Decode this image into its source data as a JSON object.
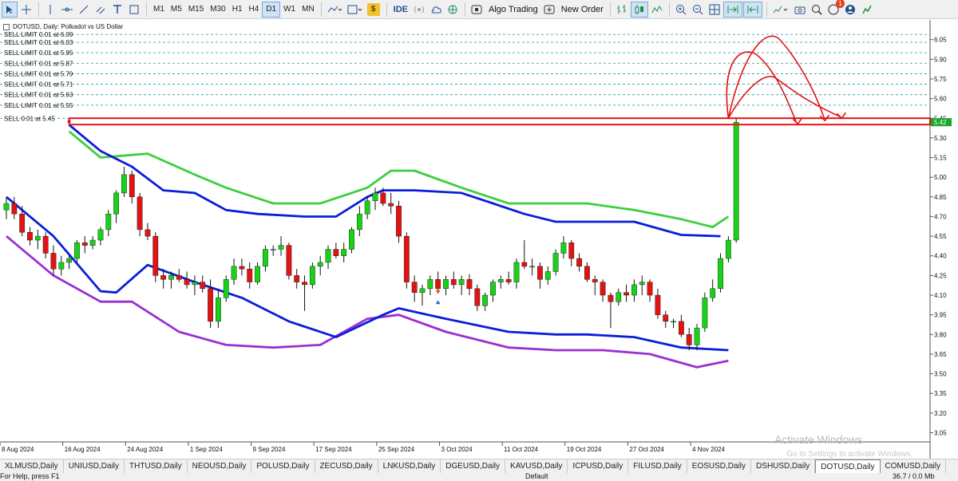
{
  "toolbar": {
    "timeframes": [
      "M1",
      "M5",
      "M15",
      "M30",
      "H1",
      "H4",
      "D1",
      "W1",
      "MN"
    ],
    "active_timeframe": "D1",
    "ide_label": "IDE",
    "algo_label": "Algo Trading",
    "new_order_label": "New Order",
    "notification_count": "1"
  },
  "chart": {
    "symbol": "DOTUSD",
    "timeframe": "Daily",
    "description": "Polkadot vs US Dollar",
    "header": "DOTUSD, Daily:  Polkadot vs US Dollar",
    "current_price": "5.42",
    "orders": [
      "SELL LIMIT 0.01 at 6.09",
      "SELL LIMIT 0.01 at 6.03",
      "SELL LIMIT 0.01 at 5.95",
      "SELL LIMIT 0.01 at 5.87",
      "SELL LIMIT 0.01 at 5.79",
      "SELL LIMIT 0.01 at 5.71",
      "SELL LIMIT 0.01 at 5.63",
      "SELL LIMIT 0.01 at 5.55",
      "SELL 0.01 at 5.45"
    ]
  },
  "chart_data": {
    "type": "candlestick",
    "title": "DOTUSD, Daily:  Polkadot vs US Dollar",
    "y_ticks": [
      6.05,
      5.9,
      5.75,
      5.6,
      5.45,
      5.3,
      5.15,
      5.0,
      4.85,
      4.7,
      4.55,
      4.4,
      4.25,
      4.1,
      3.95,
      3.8,
      3.65,
      3.5,
      3.35,
      3.2,
      3.05
    ],
    "y_tick_labels": [
      "6.05",
      "5.90",
      "5.75",
      "5.60",
      "5.45",
      "5.30",
      "5.15",
      "5.00",
      "4.85",
      "4.70",
      "4.55",
      "4.40",
      "4.25",
      "4.10",
      "3.95",
      "3.80",
      "3.65",
      "3.50",
      "3.35",
      "3.20",
      "3.05"
    ],
    "ylim": [
      2.98,
      6.17
    ],
    "x_tick_labels": [
      "8 Aug 2024",
      "16 Aug 2024",
      "24 Aug 2024",
      "1 Sep 2024",
      "9 Sep 2024",
      "17 Sep 2024",
      "25 Sep 2024",
      "3 Oct 2024",
      "11 Oct 2024",
      "19 Oct 2024",
      "27 Oct 2024",
      "4 Nov 2024"
    ],
    "x_tick_days": [
      0,
      8,
      16,
      24,
      32,
      40,
      48,
      56,
      64,
      72,
      80,
      88
    ],
    "grid": false,
    "colors": {
      "up": "#19d119",
      "down": "#e01414",
      "mid_band": "#0a1ed8",
      "upper_band": "#3ccf3c",
      "lower_band": "#9b2fd0",
      "orders": "#1a9a9a",
      "hline": "#e01414",
      "annotation": "#e01414"
    },
    "candles": [
      {
        "o": 4.75,
        "h": 4.85,
        "l": 4.68,
        "c": 4.8
      },
      {
        "o": 4.8,
        "h": 4.85,
        "l": 4.68,
        "c": 4.72
      },
      {
        "o": 4.72,
        "h": 4.78,
        "l": 4.55,
        "c": 4.58
      },
      {
        "o": 4.58,
        "h": 4.62,
        "l": 4.48,
        "c": 4.52
      },
      {
        "o": 4.52,
        "h": 4.6,
        "l": 4.45,
        "c": 4.55
      },
      {
        "o": 4.55,
        "h": 4.58,
        "l": 4.38,
        "c": 4.42
      },
      {
        "o": 4.42,
        "h": 4.48,
        "l": 4.25,
        "c": 4.3
      },
      {
        "o": 4.3,
        "h": 4.4,
        "l": 4.25,
        "c": 4.35
      },
      {
        "o": 4.35,
        "h": 4.4,
        "l": 4.3,
        "c": 4.38
      },
      {
        "o": 4.38,
        "h": 4.52,
        "l": 4.35,
        "c": 4.5
      },
      {
        "o": 4.5,
        "h": 4.55,
        "l": 4.42,
        "c": 4.48
      },
      {
        "o": 4.48,
        "h": 4.55,
        "l": 4.45,
        "c": 4.52
      },
      {
        "o": 4.52,
        "h": 4.62,
        "l": 4.48,
        "c": 4.6
      },
      {
        "o": 4.6,
        "h": 4.75,
        "l": 4.55,
        "c": 4.72
      },
      {
        "o": 4.72,
        "h": 4.9,
        "l": 4.65,
        "c": 4.88
      },
      {
        "o": 4.88,
        "h": 5.08,
        "l": 4.85,
        "c": 5.02
      },
      {
        "o": 5.02,
        "h": 5.05,
        "l": 4.8,
        "c": 4.85
      },
      {
        "o": 4.85,
        "h": 4.88,
        "l": 4.55,
        "c": 4.6
      },
      {
        "o": 4.6,
        "h": 4.65,
        "l": 4.52,
        "c": 4.55
      },
      {
        "o": 4.55,
        "h": 4.58,
        "l": 4.2,
        "c": 4.25
      },
      {
        "o": 4.25,
        "h": 4.3,
        "l": 4.15,
        "c": 4.22
      },
      {
        "o": 4.22,
        "h": 4.28,
        "l": 4.15,
        "c": 4.25
      },
      {
        "o": 4.25,
        "h": 4.3,
        "l": 4.2,
        "c": 4.22
      },
      {
        "o": 4.22,
        "h": 4.28,
        "l": 4.15,
        "c": 4.18
      },
      {
        "o": 4.18,
        "h": 4.25,
        "l": 4.1,
        "c": 4.2
      },
      {
        "o": 4.2,
        "h": 4.25,
        "l": 4.12,
        "c": 4.15
      },
      {
        "o": 4.15,
        "h": 4.22,
        "l": 3.85,
        "c": 3.9
      },
      {
        "o": 3.9,
        "h": 4.15,
        "l": 3.85,
        "c": 4.08
      },
      {
        "o": 4.08,
        "h": 4.25,
        "l": 4.05,
        "c": 4.22
      },
      {
        "o": 4.22,
        "h": 4.38,
        "l": 4.18,
        "c": 4.32
      },
      {
        "o": 4.32,
        "h": 4.38,
        "l": 4.25,
        "c": 4.3
      },
      {
        "o": 4.3,
        "h": 4.35,
        "l": 4.15,
        "c": 4.2
      },
      {
        "o": 4.2,
        "h": 4.35,
        "l": 4.18,
        "c": 4.32
      },
      {
        "o": 4.32,
        "h": 4.48,
        "l": 4.28,
        "c": 4.45
      },
      {
        "o": 4.45,
        "h": 4.48,
        "l": 4.4,
        "c": 4.45
      },
      {
        "o": 4.45,
        "h": 4.55,
        "l": 4.4,
        "c": 4.48
      },
      {
        "o": 4.48,
        "h": 4.5,
        "l": 4.22,
        "c": 4.25
      },
      {
        "o": 4.25,
        "h": 4.3,
        "l": 4.15,
        "c": 4.2
      },
      {
        "o": 4.2,
        "h": 4.25,
        "l": 3.98,
        "c": 4.18
      },
      {
        "o": 4.18,
        "h": 4.35,
        "l": 4.15,
        "c": 4.32
      },
      {
        "o": 4.32,
        "h": 4.4,
        "l": 4.25,
        "c": 4.35
      },
      {
        "o": 4.35,
        "h": 4.48,
        "l": 4.3,
        "c": 4.45
      },
      {
        "o": 4.45,
        "h": 4.5,
        "l": 4.38,
        "c": 4.4
      },
      {
        "o": 4.4,
        "h": 4.5,
        "l": 4.35,
        "c": 4.45
      },
      {
        "o": 4.45,
        "h": 4.62,
        "l": 4.42,
        "c": 4.6
      },
      {
        "o": 4.6,
        "h": 4.78,
        "l": 4.55,
        "c": 4.72
      },
      {
        "o": 4.72,
        "h": 4.85,
        "l": 4.68,
        "c": 4.82
      },
      {
        "o": 4.82,
        "h": 4.92,
        "l": 4.75,
        "c": 4.88
      },
      {
        "o": 4.88,
        "h": 4.92,
        "l": 4.78,
        "c": 4.8
      },
      {
        "o": 4.8,
        "h": 4.88,
        "l": 4.72,
        "c": 4.78
      },
      {
        "o": 4.78,
        "h": 4.82,
        "l": 4.5,
        "c": 4.55
      },
      {
        "o": 4.55,
        "h": 4.58,
        "l": 4.15,
        "c": 4.2
      },
      {
        "o": 4.2,
        "h": 4.25,
        "l": 4.05,
        "c": 4.12
      },
      {
        "o": 4.12,
        "h": 4.18,
        "l": 4.02,
        "c": 4.15
      },
      {
        "o": 4.15,
        "h": 4.25,
        "l": 4.1,
        "c": 4.22
      },
      {
        "o": 4.22,
        "h": 4.28,
        "l": 4.12,
        "c": 4.15
      },
      {
        "o": 4.15,
        "h": 4.25,
        "l": 4.1,
        "c": 4.22
      },
      {
        "o": 4.22,
        "h": 4.28,
        "l": 4.15,
        "c": 4.18
      },
      {
        "o": 4.18,
        "h": 4.25,
        "l": 4.1,
        "c": 4.22
      },
      {
        "o": 4.22,
        "h": 4.26,
        "l": 4.1,
        "c": 4.15
      },
      {
        "o": 4.15,
        "h": 4.18,
        "l": 3.98,
        "c": 4.02
      },
      {
        "o": 4.02,
        "h": 4.12,
        "l": 3.98,
        "c": 4.1
      },
      {
        "o": 4.1,
        "h": 4.22,
        "l": 4.05,
        "c": 4.2
      },
      {
        "o": 4.2,
        "h": 4.25,
        "l": 4.15,
        "c": 4.22
      },
      {
        "o": 4.22,
        "h": 4.28,
        "l": 4.18,
        "c": 4.2
      },
      {
        "o": 4.2,
        "h": 4.38,
        "l": 4.15,
        "c": 4.35
      },
      {
        "o": 4.35,
        "h": 4.52,
        "l": 4.3,
        "c": 4.32
      },
      {
        "o": 4.32,
        "h": 4.38,
        "l": 4.25,
        "c": 4.32
      },
      {
        "o": 4.32,
        "h": 4.35,
        "l": 4.15,
        "c": 4.22
      },
      {
        "o": 4.22,
        "h": 4.32,
        "l": 4.18,
        "c": 4.28
      },
      {
        "o": 4.28,
        "h": 4.45,
        "l": 4.25,
        "c": 4.42
      },
      {
        "o": 4.42,
        "h": 4.55,
        "l": 4.38,
        "c": 4.5
      },
      {
        "o": 4.5,
        "h": 4.52,
        "l": 4.32,
        "c": 4.38
      },
      {
        "o": 4.38,
        "h": 4.42,
        "l": 4.28,
        "c": 4.32
      },
      {
        "o": 4.32,
        "h": 4.35,
        "l": 4.2,
        "c": 4.22
      },
      {
        "o": 4.22,
        "h": 4.25,
        "l": 4.1,
        "c": 4.2
      },
      {
        "o": 4.2,
        "h": 4.22,
        "l": 4.05,
        "c": 4.1
      },
      {
        "o": 4.1,
        "h": 4.12,
        "l": 3.85,
        "c": 4.05
      },
      {
        "o": 4.05,
        "h": 4.15,
        "l": 4.02,
        "c": 4.12
      },
      {
        "o": 4.12,
        "h": 4.18,
        "l": 4.05,
        "c": 4.1
      },
      {
        "o": 4.1,
        "h": 4.22,
        "l": 4.05,
        "c": 4.18
      },
      {
        "o": 4.18,
        "h": 4.25,
        "l": 4.1,
        "c": 4.2
      },
      {
        "o": 4.2,
        "h": 4.22,
        "l": 4.05,
        "c": 4.1
      },
      {
        "o": 4.1,
        "h": 4.15,
        "l": 3.92,
        "c": 3.95
      },
      {
        "o": 3.95,
        "h": 3.98,
        "l": 3.85,
        "c": 3.9
      },
      {
        "o": 3.9,
        "h": 3.92,
        "l": 3.85,
        "c": 3.9
      },
      {
        "o": 3.9,
        "h": 3.95,
        "l": 3.78,
        "c": 3.8
      },
      {
        "o": 3.8,
        "h": 3.85,
        "l": 3.68,
        "c": 3.72
      },
      {
        "o": 3.72,
        "h": 3.88,
        "l": 3.68,
        "c": 3.85
      },
      {
        "o": 3.85,
        "h": 4.12,
        "l": 3.82,
        "c": 4.08
      },
      {
        "o": 4.08,
        "h": 4.22,
        "l": 4.05,
        "c": 4.15
      },
      {
        "o": 4.15,
        "h": 4.42,
        "l": 4.12,
        "c": 4.38
      },
      {
        "o": 4.38,
        "h": 4.55,
        "l": 4.35,
        "c": 4.52
      },
      {
        "o": 4.52,
        "h": 5.45,
        "l": 4.5,
        "c": 5.42
      }
    ],
    "bands": {
      "upper": [
        [
          8,
          5.35
        ],
        [
          12,
          5.15
        ],
        [
          18,
          5.18
        ],
        [
          24,
          5.02
        ],
        [
          28,
          4.92
        ],
        [
          34,
          4.8
        ],
        [
          40,
          4.8
        ],
        [
          46,
          4.92
        ],
        [
          49,
          5.05
        ],
        [
          52,
          5.05
        ],
        [
          58,
          4.92
        ],
        [
          64,
          4.8
        ],
        [
          70,
          4.8
        ],
        [
          74,
          4.8
        ],
        [
          80,
          4.75
        ],
        [
          86,
          4.68
        ],
        [
          90,
          4.62
        ],
        [
          92,
          4.7
        ]
      ],
      "mid": [
        [
          0,
          4.85
        ],
        [
          6,
          4.55
        ],
        [
          12,
          4.13
        ],
        [
          14,
          4.12
        ],
        [
          18,
          4.33
        ],
        [
          24,
          4.2
        ],
        [
          30,
          4.08
        ],
        [
          36,
          3.9
        ],
        [
          42,
          3.78
        ],
        [
          48,
          3.95
        ],
        [
          50,
          4.0
        ],
        [
          56,
          3.92
        ],
        [
          64,
          3.82
        ],
        [
          70,
          3.8
        ],
        [
          74,
          3.8
        ],
        [
          80,
          3.78
        ],
        [
          86,
          3.7
        ],
        [
          92,
          3.68
        ]
      ],
      "lower": [
        [
          0,
          4.55
        ],
        [
          6,
          4.25
        ],
        [
          12,
          4.05
        ],
        [
          16,
          4.05
        ],
        [
          22,
          3.82
        ],
        [
          28,
          3.72
        ],
        [
          34,
          3.7
        ],
        [
          40,
          3.72
        ],
        [
          46,
          3.92
        ],
        [
          50,
          3.95
        ],
        [
          56,
          3.82
        ],
        [
          64,
          3.7
        ],
        [
          70,
          3.68
        ],
        [
          76,
          3.68
        ],
        [
          82,
          3.65
        ],
        [
          88,
          3.55
        ],
        [
          92,
          3.6
        ]
      ],
      "mid_upper_segment": [
        [
          8,
          5.4
        ],
        [
          12,
          5.2
        ],
        [
          16,
          5.08
        ],
        [
          20,
          4.9
        ],
        [
          24,
          4.88
        ],
        [
          28,
          4.75
        ],
        [
          32,
          4.72
        ],
        [
          38,
          4.7
        ],
        [
          42,
          4.7
        ],
        [
          46,
          4.85
        ],
        [
          48,
          4.9
        ],
        [
          52,
          4.9
        ],
        [
          58,
          4.88
        ],
        [
          62,
          4.8
        ],
        [
          66,
          4.72
        ],
        [
          70,
          4.66
        ],
        [
          74,
          4.66
        ],
        [
          80,
          4.66
        ],
        [
          86,
          4.56
        ],
        [
          91,
          4.55
        ]
      ]
    },
    "hline_price": 5.42
  },
  "tabs": [
    "XLMUSD,Daily",
    "UNIUSD,Daily",
    "THTUSD,Daily",
    "NEOUSD,Daily",
    "POLUSD,Daily",
    "ZECUSD,Daily",
    "LNKUSD,Daily",
    "DGEUSD,Daily",
    "KAVUSD,Daily",
    "ICPUSD,Daily",
    "FILUSD,Daily",
    "EOSUSD,Daily",
    "DSHUSD,Daily",
    "DOTUSD,Daily",
    "COMUSD,Daily"
  ],
  "active_tab": "DOTUSD,Daily",
  "status": {
    "left": "For Help, press F1",
    "mid": "Default",
    "right": "36.7 / 0.0 Mb"
  },
  "watermark": {
    "title": "Activate Windows",
    "subtitle": "Go to Settings to activate Windows."
  }
}
